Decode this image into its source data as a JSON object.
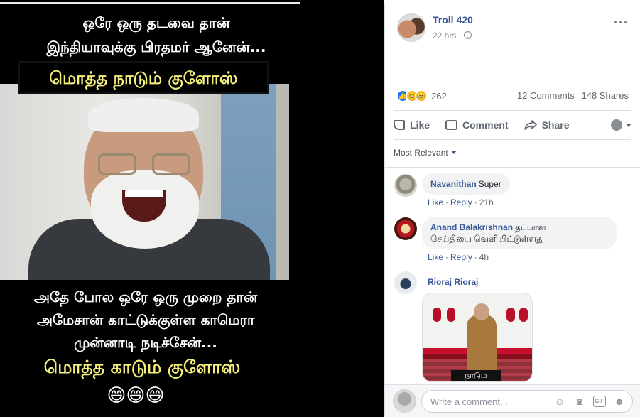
{
  "meme": {
    "line1": "ஒரே ஒரு தடவை தான்",
    "line2": "இந்தியாவுக்கு பிரதமர் ஆனேன்...",
    "banner1": "மொத்த நாடும் குளோஸ்",
    "line3": "அதே போல ஒரே ஒரு முறை தான்",
    "line4": "அமேசான் காட்டுக்குள்ள காமெரா",
    "line5": "முன்னாடி நடிச்சேன்...",
    "banner2": "மொத்த காடும் குளோஸ்",
    "emojis": "😄😄😄"
  },
  "post": {
    "page_name": "Troll 420",
    "time": "22 hrs",
    "more": "···"
  },
  "stats": {
    "reaction_like": "👍",
    "reaction_haha": "😆",
    "reaction_sad": "😥",
    "reaction_count": "262",
    "comments": "12 Comments",
    "shares": "148 Shares"
  },
  "actions": {
    "like": "Like",
    "comment": "Comment",
    "share": "Share"
  },
  "sort_label": "Most Relevant",
  "comments": [
    {
      "author": "Navanithan",
      "text": "Super",
      "like": "Like",
      "reply": "Reply",
      "time": "21h"
    },
    {
      "author": "Anand Balakrishnan",
      "text_line1": "தப்பான",
      "text_line2": "செய்தியை வெளியிட்டுள்ளது",
      "like": "Like",
      "reply": "Reply",
      "time": "4h"
    },
    {
      "author": "Rioraj Rioraj",
      "image_caption": "நாடும"
    }
  ],
  "composer": {
    "placeholder": "Write a comment..."
  },
  "colors": {
    "link_blue": "#385898",
    "meme_yellow": "#f5f07c",
    "fb_like_blue": "#1877f2"
  }
}
